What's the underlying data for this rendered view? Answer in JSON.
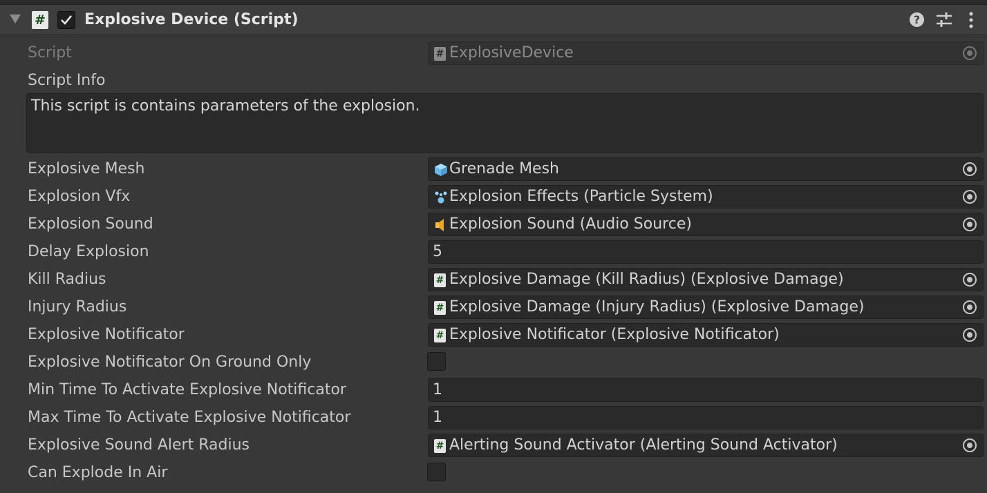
{
  "component": {
    "title": "Explosive Device (Script)",
    "enabled": true,
    "icons": [
      "foldout-arrow-icon",
      "script-hash-icon",
      "help-icon",
      "preset-icon",
      "kebab-menu-icon"
    ]
  },
  "script": {
    "label": "Script",
    "value": "ExplosiveDevice"
  },
  "script_info": {
    "label": "Script Info",
    "text": "This script is contains parameters  of the explosion."
  },
  "fields": {
    "explosive_mesh": {
      "label": "Explosive Mesh",
      "value": "Grenade Mesh",
      "icon": "mesh-cube-icon"
    },
    "explosion_vfx": {
      "label": "Explosion Vfx",
      "value": "Explosion Effects (Particle System)",
      "icon": "particle-system-icon"
    },
    "explosion_sound": {
      "label": "Explosion Sound",
      "value": "Explosion Sound (Audio Source)",
      "icon": "audio-source-icon"
    },
    "delay_explosion": {
      "label": "Delay Explosion",
      "value": "5"
    },
    "kill_radius": {
      "label": "Kill Radius",
      "value": "Explosive Damage (Kill Radius) (Explosive Damage)",
      "icon": "script-hash-icon"
    },
    "injury_radius": {
      "label": "Injury Radius",
      "value": "Explosive Damage (Injury Radius) (Explosive Damage)",
      "icon": "script-hash-icon"
    },
    "explosive_notificator": {
      "label": "Explosive Notificator",
      "value": "Explosive Notificator (Explosive Notificator)",
      "icon": "script-hash-icon"
    },
    "notificator_on_ground_only": {
      "label": "Explosive Notificator On Ground Only",
      "checked": false
    },
    "min_time": {
      "label": "Min Time To Activate Explosive Notificator",
      "value": "1"
    },
    "max_time": {
      "label": "Max Time To Activate Explosive Notificator",
      "value": "1"
    },
    "sound_alert_radius": {
      "label": "Explosive Sound Alert Radius",
      "value": "Alerting Sound Activator (Alerting Sound Activator)",
      "icon": "script-hash-icon"
    },
    "can_explode_in_air": {
      "label": "Can Explode In Air",
      "checked": false
    }
  },
  "colors": {
    "background": "#383838",
    "field_background": "#2a2a2a",
    "mesh_icon": "#7cc4f0",
    "audio_icon": "#e8b33a",
    "script_icon_hash": "#1e5a1e"
  }
}
